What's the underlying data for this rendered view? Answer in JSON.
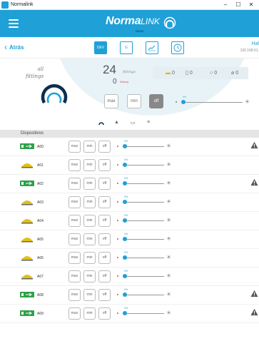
{
  "window": {
    "title": "Normalink",
    "controls": [
      "–",
      "☐",
      "✕"
    ]
  },
  "app": {
    "brand_primary": "Norma",
    "brand_secondary": "LINK",
    "brand_small": "BEMS",
    "accent": "#1fa0d6"
  },
  "nav": {
    "back_label": "Atrás",
    "tabs": [
      {
        "label": "DEV",
        "active": true
      },
      {
        "label": "G",
        "active": false
      },
      {
        "label": "",
        "icon": "chart-icon",
        "active": false
      },
      {
        "label": "",
        "icon": "clock-icon",
        "active": false
      }
    ],
    "connection_name": "Hal",
    "connection_ip": "192.168.51."
  },
  "all_fittings": {
    "label_line1": "all",
    "label_line2": "fittings",
    "count": "24",
    "count_label": "fittings",
    "missing_count": "0",
    "missing_label": "Missing",
    "stats": [
      "0",
      "0",
      "0",
      "0"
    ],
    "buttons": [
      "max",
      "min",
      "off"
    ],
    "slider_value_pct": 0,
    "slider_label": "0%"
  },
  "devices": {
    "header": "Dispositivos",
    "button_labels": [
      "max",
      "min",
      "off"
    ],
    "items": [
      {
        "name": "A00",
        "type": "emergency",
        "warning": true,
        "level_pct": 0,
        "level_label": "0%"
      },
      {
        "name": "A01",
        "type": "lamp",
        "warning": false,
        "level_pct": 0,
        "level_label": "0%"
      },
      {
        "name": "A02",
        "type": "emergency",
        "warning": true,
        "level_pct": 0,
        "level_label": "0%"
      },
      {
        "name": "A03",
        "type": "lamp",
        "warning": false,
        "level_pct": 0,
        "level_label": "0%"
      },
      {
        "name": "A04",
        "type": "lamp",
        "warning": false,
        "level_pct": 0,
        "level_label": "0%"
      },
      {
        "name": "A05",
        "type": "lamp",
        "warning": false,
        "level_pct": 0,
        "level_label": "0%"
      },
      {
        "name": "A06",
        "type": "lamp",
        "warning": false,
        "level_pct": 0,
        "level_label": "0%"
      },
      {
        "name": "A07",
        "type": "lamp",
        "warning": false,
        "level_pct": 0,
        "level_label": "0%"
      },
      {
        "name": "A08",
        "type": "emergency",
        "warning": true,
        "level_pct": 0,
        "level_label": "0%"
      },
      {
        "name": "A09",
        "type": "emergency",
        "warning": true,
        "level_pct": 0,
        "level_label": "0%"
      }
    ]
  }
}
